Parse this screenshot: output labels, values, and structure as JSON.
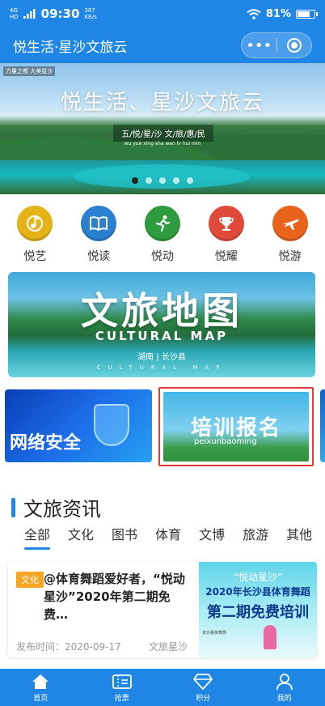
{
  "status_bar": {
    "network": "4G",
    "network_sub": "HD",
    "time": "09:30",
    "speed_value": "387",
    "speed_unit": "KB/s",
    "battery_percent": "81%",
    "battery_level": 0.81
  },
  "title_bar": {
    "title": "悦生活·星沙文旅云"
  },
  "banner": {
    "tagline": "力量之都 大美星沙",
    "title": "悦生活、星沙文旅云",
    "subtitle": "五/悦/星/沙 文/旅/惠/民",
    "pinyin": "wu yue xing sha wen lv hui min",
    "slide_count": 5,
    "active_slide": 0
  },
  "categories": [
    {
      "label": "悦艺",
      "icon": "music-note-icon",
      "color": "#e3b318"
    },
    {
      "label": "悦读",
      "icon": "book-icon",
      "color": "#2a7fd0"
    },
    {
      "label": "悦动",
      "icon": "running-icon",
      "color": "#2e9b3e"
    },
    {
      "label": "悦耀",
      "icon": "trophy-icon",
      "color": "#e04a3a"
    },
    {
      "label": "悦游",
      "icon": "airplane-icon",
      "color": "#e8641c"
    }
  ],
  "map_card": {
    "title": "文旅地图",
    "subtitle": "CULTURAL MAP",
    "location": "湖南 | 长沙县",
    "footer": "CULTURAL MAP"
  },
  "promo_cards": {
    "security": "网络安全",
    "training": "培训报名",
    "training_pinyin": "peixunbaoming"
  },
  "news_section": {
    "title": "文旅资讯",
    "tabs": [
      "全部",
      "文化",
      "图书",
      "体育",
      "文博",
      "旅游",
      "其他"
    ],
    "active_tab": 0
  },
  "news_items": [
    {
      "tag": "文化",
      "headline": "@体育舞蹈爱好者，“悦动星沙”2020年第二期免费…",
      "date": "发布时间：2020-09-17",
      "source": "文旅星沙",
      "thumb_line1": "“悦动星沙”",
      "thumb_line2": "2020年长沙县体育舞蹈",
      "thumb_line3": "第二期免费培训",
      "thumb_org": "长沙县体育局"
    }
  ],
  "tab_bar": [
    {
      "label": "首页",
      "icon": "home-icon"
    },
    {
      "label": "抢票",
      "icon": "ticket-icon"
    },
    {
      "label": "积分",
      "icon": "diamond-icon"
    },
    {
      "label": "我的",
      "icon": "user-icon"
    }
  ],
  "colors": {
    "primary": "#1f86e6",
    "highlight_border": "#e53935",
    "tag": "#f5a623"
  }
}
